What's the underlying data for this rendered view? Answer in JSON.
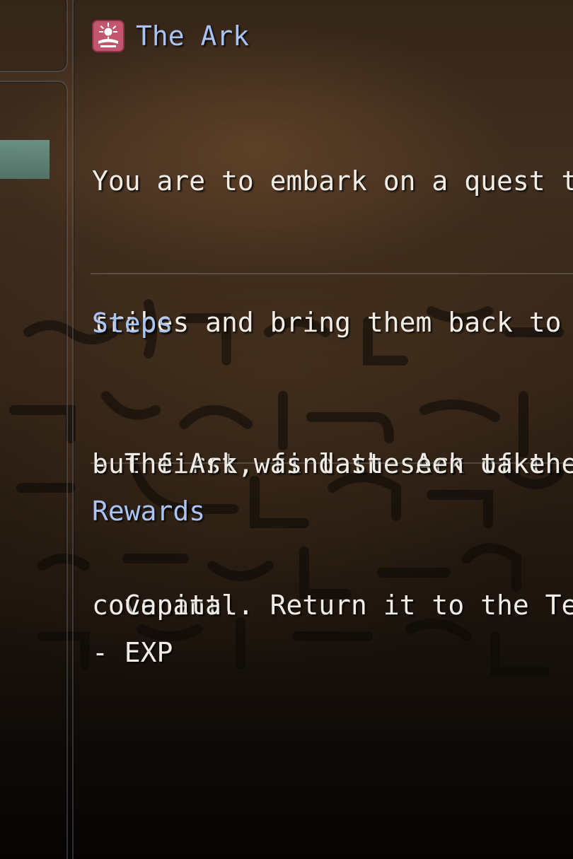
{
  "quest": {
    "title": "The Ark",
    "icon": "sun-emblem-icon",
    "description_lines": [
      "You are to embark on a quest to",
      "tribes and bring them back to t",
      "but first, find the Ark of the",
      "covenant.  Return it to the Tem"
    ]
  },
  "steps": {
    "heading": "Steps",
    "lines": [
      "- The Ark was last seen taken t",
      "  Capital."
    ]
  },
  "rewards": {
    "heading": "Rewards",
    "lines": [
      "- EXP"
    ]
  },
  "colors": {
    "heading": "#a9c3f2",
    "body_text": "#f1ece4",
    "selection": "#78afa5",
    "icon_bg": "#c2566f"
  }
}
